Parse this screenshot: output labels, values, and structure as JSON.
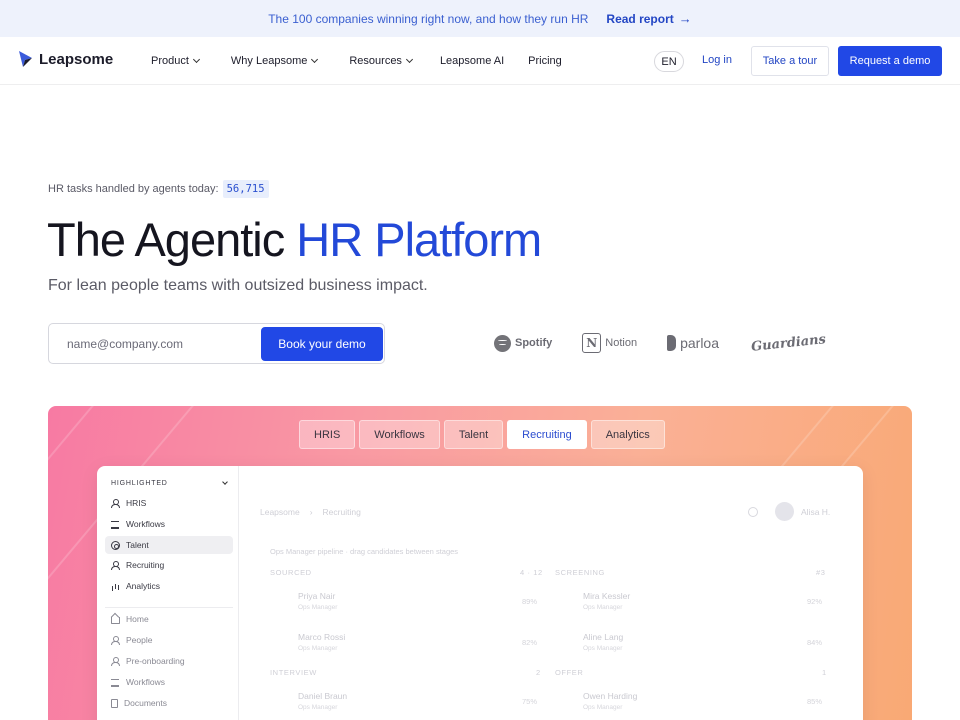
{
  "announcement": {
    "text": "The 100 companies winning right now, and how they run HR",
    "link_label": "Read report",
    "arrow": "→"
  },
  "header": {
    "logo": "Leapsome",
    "nav": [
      {
        "label": "Product",
        "dropdown": true
      },
      {
        "label": "Why Leapsome",
        "dropdown": true
      },
      {
        "label": "Resources",
        "dropdown": true
      },
      {
        "label": "Leapsome AI",
        "dropdown": false
      },
      {
        "label": "Pricing",
        "dropdown": false
      }
    ],
    "language": "EN",
    "login_label": "Log in",
    "tour_label": "Take a tour",
    "demo_label": "Request a demo"
  },
  "hero": {
    "counter_label": "HR tasks handled by agents today:",
    "counter_value": "56,715",
    "headline_plain": "The Agentic ",
    "headline_accent": "HR Platform",
    "subhead": "For lean people teams with outsized business impact.",
    "email_placeholder": "name@company.com",
    "book_label": "Book your demo",
    "customer_logos": [
      "Spotify",
      "Notion",
      "parloa",
      "Guardians"
    ]
  },
  "showcase": {
    "tabs": [
      "HRIS",
      "Workflows",
      "Talent",
      "Recruiting",
      "Analytics"
    ],
    "active_tab": "Recruiting",
    "sidebar": {
      "section_label": "HIGHLIGHTED",
      "highlighted": [
        {
          "label": "HRIS",
          "icon": "people-icon"
        },
        {
          "label": "Workflows",
          "icon": "list-icon"
        },
        {
          "label": "Talent",
          "icon": "target-icon"
        },
        {
          "label": "Recruiting",
          "icon": "people-add-icon"
        },
        {
          "label": "Analytics",
          "icon": "bars-icon"
        }
      ],
      "selected": "Talent",
      "other": [
        {
          "label": "Home",
          "icon": "home-icon"
        },
        {
          "label": "People",
          "icon": "people-icon"
        },
        {
          "label": "Pre-onboarding",
          "icon": "people-add-icon"
        },
        {
          "label": "Workflows",
          "icon": "list-icon"
        },
        {
          "label": "Documents",
          "icon": "doc-icon"
        }
      ]
    },
    "app": {
      "breadcrumb": [
        "Leapsome",
        "›",
        "Recruiting"
      ],
      "user": "Alisa H.",
      "caption": "Ops Manager pipeline · drag candidates between stages",
      "columns": [
        {
          "stage": "SOURCED",
          "count": "4 · 12",
          "candidates": [
            {
              "name": "Priya Nair",
              "role": "Ops Manager",
              "score": "89%"
            },
            {
              "name": "Marco Rossi",
              "role": "Ops Manager",
              "score": "82%"
            }
          ]
        },
        {
          "stage": "SCREENING",
          "count": "#3",
          "candidates": [
            {
              "name": "Mira Kessler",
              "role": "Ops Manager",
              "score": "92%"
            },
            {
              "name": "Aline Lang",
              "role": "Ops Manager",
              "score": "84%"
            }
          ]
        },
        {
          "stage": "INTERVIEW",
          "count": "2",
          "candidates": [
            {
              "name": "Daniel Braun",
              "role": "Ops Manager",
              "score": "75%"
            }
          ]
        },
        {
          "stage": "OFFER",
          "count": "1",
          "candidates": [
            {
              "name": "Owen Harding",
              "role": "Ops Manager",
              "score": "85%"
            }
          ]
        }
      ]
    }
  },
  "colors": {
    "brand_blue": "#2148e6",
    "accent_text": "#2349d8",
    "announce_bg": "#eef2fc"
  }
}
